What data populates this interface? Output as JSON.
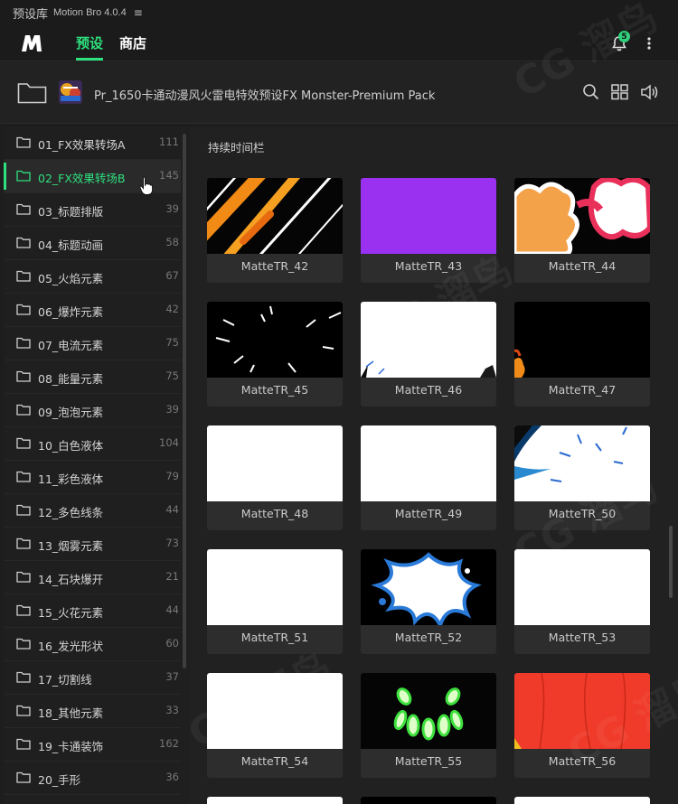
{
  "titlebar": {
    "app_title": "预设库",
    "app_version": "Motion Bro 4.0.4",
    "menu_glyph": "≡"
  },
  "nav": {
    "tabs": [
      {
        "label": "预设",
        "active": true
      },
      {
        "label": "商店",
        "active": false
      }
    ],
    "notification_count": "5",
    "accent": "#2ee07e"
  },
  "pack": {
    "title": "Pr_1650卡通动漫风火雷电特效预设FX Monster-Premium Pack"
  },
  "sidebar": {
    "items": [
      {
        "label": "01_FX效果转场A",
        "count": "111"
      },
      {
        "label": "02_FX效果转场B",
        "count": "145",
        "active": true
      },
      {
        "label": "03_标题排版",
        "count": "39"
      },
      {
        "label": "04_标题动画",
        "count": "58"
      },
      {
        "label": "05_火焰元素",
        "count": "67"
      },
      {
        "label": "06_爆炸元素",
        "count": "42"
      },
      {
        "label": "07_电流元素",
        "count": "75"
      },
      {
        "label": "08_能量元素",
        "count": "75"
      },
      {
        "label": "09_泡泡元素",
        "count": "39"
      },
      {
        "label": "10_白色液体",
        "count": "104"
      },
      {
        "label": "11_彩色液体",
        "count": "79"
      },
      {
        "label": "12_多色线条",
        "count": "44"
      },
      {
        "label": "13_烟雾元素",
        "count": "73"
      },
      {
        "label": "14_石块爆开",
        "count": "21"
      },
      {
        "label": "15_火花元素",
        "count": "44"
      },
      {
        "label": "16_发光形状",
        "count": "60"
      },
      {
        "label": "17_切割线",
        "count": "37"
      },
      {
        "label": "18_其他元素",
        "count": "33"
      },
      {
        "label": "19_卡通装饰",
        "count": "162"
      },
      {
        "label": "20_手形",
        "count": "36"
      }
    ]
  },
  "main": {
    "section_title": "持续时间栏",
    "presets": [
      {
        "name": "MatteTR_42"
      },
      {
        "name": "MatteTR_43"
      },
      {
        "name": "MatteTR_44"
      },
      {
        "name": "MatteTR_45"
      },
      {
        "name": "MatteTR_46"
      },
      {
        "name": "MatteTR_47"
      },
      {
        "name": "MatteTR_48"
      },
      {
        "name": "MatteTR_49"
      },
      {
        "name": "MatteTR_50"
      },
      {
        "name": "MatteTR_51"
      },
      {
        "name": "MatteTR_52"
      },
      {
        "name": "MatteTR_53"
      },
      {
        "name": "MatteTR_54"
      },
      {
        "name": "MatteTR_55"
      },
      {
        "name": "MatteTR_56"
      }
    ]
  },
  "watermark": {
    "text": "CG 溜鸟"
  }
}
